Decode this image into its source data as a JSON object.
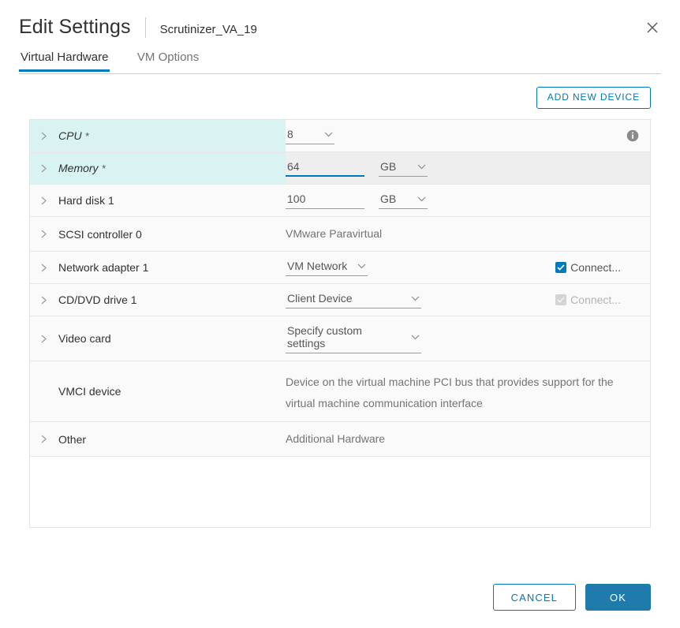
{
  "header": {
    "title": "Edit Settings",
    "subject": "Scrutinizer_VA_19",
    "close_icon": "close-icon"
  },
  "tabs": [
    {
      "label": "Virtual Hardware",
      "active": true
    },
    {
      "label": "VM Options",
      "active": false
    }
  ],
  "toolbar": {
    "add_device_label": "ADD NEW DEVICE"
  },
  "rows": {
    "cpu": {
      "label": "CPU",
      "required_marker": "*",
      "value": "8",
      "info_icon": "info-icon"
    },
    "memory": {
      "label": "Memory",
      "required_marker": "*",
      "value": "64",
      "unit": "GB"
    },
    "harddisk": {
      "label": "Hard disk 1",
      "value": "100",
      "unit": "GB"
    },
    "scsi": {
      "label": "SCSI controller 0",
      "value": "VMware Paravirtual"
    },
    "network": {
      "label": "Network adapter 1",
      "value": "VM Network",
      "connect_label": "Connect...",
      "connected": true
    },
    "cddvd": {
      "label": "CD/DVD drive 1",
      "value": "Client Device",
      "connect_label": "Connect...",
      "connected": true
    },
    "video": {
      "label": "Video card",
      "value": "Specify custom settings"
    },
    "vmci": {
      "label": "VMCI device",
      "value": "Device on the virtual machine PCI bus that provides support for the virtual machine communication interface"
    },
    "other": {
      "label": "Other",
      "value": "Additional Hardware"
    }
  },
  "footer": {
    "cancel_label": "CANCEL",
    "ok_label": "OK"
  },
  "colors": {
    "accent": "#0079b8",
    "primary_button": "#1e7bab",
    "required_row": "#d9f2f2",
    "highlight_row": "#eeeeee",
    "row_bg": "#fafafa"
  }
}
